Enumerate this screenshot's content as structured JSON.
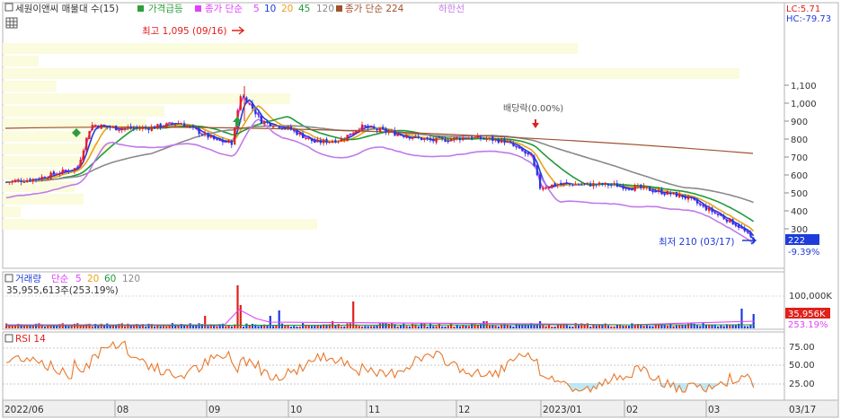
{
  "legend_main": {
    "title": "세원이앤씨 매물대 수(15)",
    "price_surge": "가격급등",
    "ma_label": "종가 단순",
    "ma_periods": [
      "5",
      "10",
      "20",
      "45",
      "120"
    ],
    "ma_colors": [
      "#e040fb",
      "#1e3cdc",
      "#e8a317",
      "#1f9a3a",
      "#8a8a8a"
    ],
    "long_ma_label": "종가 단순 224",
    "long_ma_color": "#a0522d",
    "lower_band": "하한선",
    "lower_band_color": "#c07ae8"
  },
  "axis_indicators": {
    "lc": "LC:5.71",
    "hc": "HC:-79.73"
  },
  "annotations": {
    "high": "최고 1,095 (09/16)",
    "low": "최저 210 (03/17)",
    "inverse_arrangement": "배당락(0.00%)"
  },
  "current_price": {
    "value": "222",
    "change": "-9.39%"
  },
  "volume_panel": {
    "label": "거래량",
    "ma_label": "단순",
    "ma_periods": [
      "5",
      "20",
      "60",
      "120"
    ],
    "ma_colors": [
      "#e040fb",
      "#e8a317",
      "#1f9a3a",
      "#8a8a8a"
    ],
    "summary": "35,955,613주(253.19%)",
    "badge_value": "35,956K",
    "badge_pct": "253.19%",
    "tick": "100,000K"
  },
  "rsi_panel": {
    "label": "RSI 14",
    "ticks": [
      "75.00",
      "50.00",
      "25.00"
    ]
  },
  "x_axis": {
    "labels": [
      "2022/06",
      "08",
      "09",
      "10",
      "11",
      "12",
      "2023/01",
      "02",
      "03",
      "03/17"
    ]
  },
  "chart_data": [
    {
      "type": "candlestick",
      "name": "price",
      "y_ticks": [
        300,
        400,
        500,
        600,
        700,
        800,
        900,
        1000
      ],
      "y_tick_labels": [
        "300",
        "400",
        "500",
        "600",
        "700",
        "800",
        "900",
        "1,000",
        "1,100"
      ],
      "ylim": [
        210,
        1100
      ],
      "x_range": [
        "2022-06",
        "2023-03-17"
      ],
      "high": {
        "date": "09/16",
        "value": 1095
      },
      "low": {
        "date": "03/17",
        "value": 210
      },
      "last_close": 222,
      "volume_profile_rows": 15,
      "series": [
        {
          "name": "5",
          "color": "#e040fb"
        },
        {
          "name": "10",
          "color": "#1e3cdc"
        },
        {
          "name": "20",
          "color": "#e8a317"
        },
        {
          "name": "45",
          "color": "#1f9a3a"
        },
        {
          "name": "120",
          "color": "#8a8a8a"
        },
        {
          "name": "224",
          "color": "#a0522d"
        },
        {
          "name": "하한선",
          "color": "#c07ae8"
        }
      ]
    },
    {
      "type": "bar",
      "name": "volume",
      "y_ticks": [
        100000
      ],
      "last_value_k": 35956,
      "last_pct": 253.19
    },
    {
      "type": "line",
      "name": "RSI 14",
      "y_ticks": [
        25,
        50,
        75
      ],
      "ylim": [
        0,
        100
      ]
    }
  ]
}
